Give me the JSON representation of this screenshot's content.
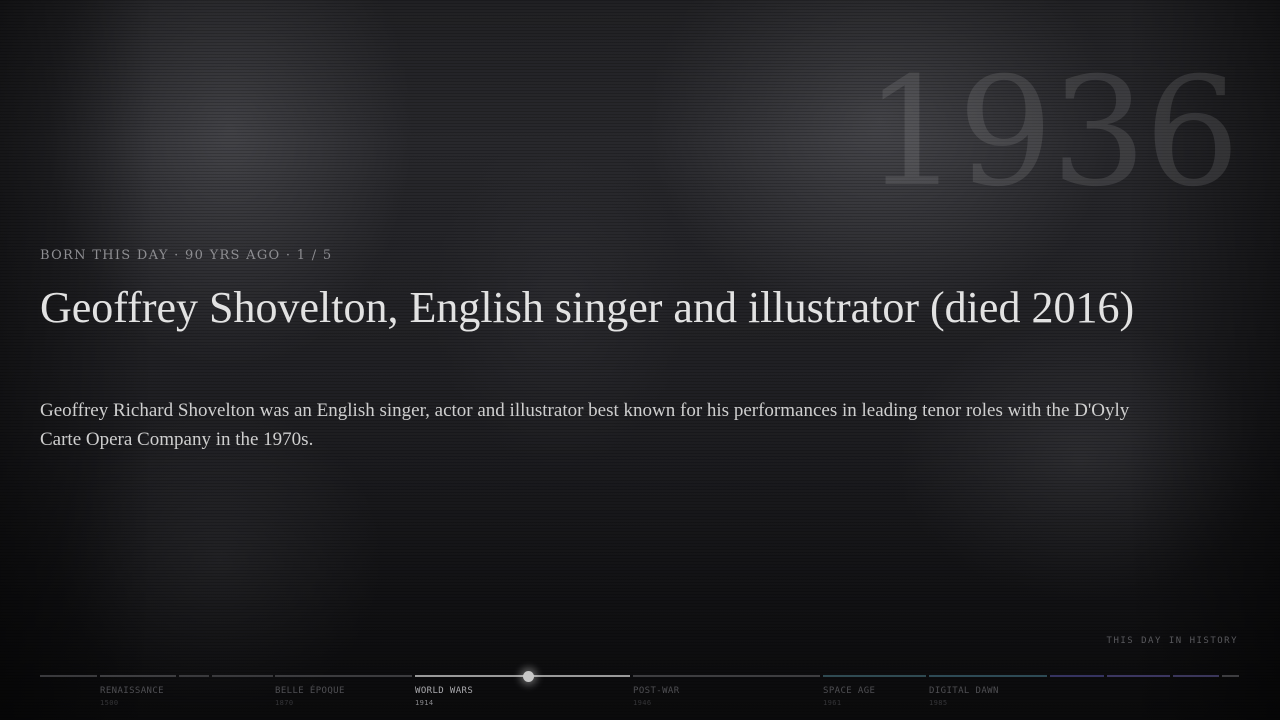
{
  "watermark_year": "1936",
  "kicker": "BORN THIS DAY · 90 YRS AGO · 1 / 5",
  "headline": "Geoffrey Shovelton, English singer and illustrator (died 2016)",
  "description": "Geoffrey Richard Shovelton was an English singer, actor and illustrator best known for his performances in leading tenor roles with the D'Oyly Carte Opera Company in the 1970s.",
  "brand": "THIS DAY IN HISTORY",
  "timeline": {
    "active_era": "WORLD WARS",
    "eras": [
      {
        "label": "RENAISSANCE",
        "year": "1500"
      },
      {
        "label": "BELLE ÉPOQUE",
        "year": "1870"
      },
      {
        "label": "WORLD WARS",
        "year": "1914"
      },
      {
        "label": "POST-WAR",
        "year": "1946"
      },
      {
        "label": "SPACE AGE",
        "year": "1961"
      },
      {
        "label": "DIGITAL DAWN",
        "year": "1985"
      }
    ]
  },
  "colors": {
    "background": "#1b1b1e",
    "headline": "#e2e2e2",
    "timeline_active": "#9a9a9a",
    "timeline_space": "#2f4a52",
    "timeline_digital": "#3b3660"
  }
}
